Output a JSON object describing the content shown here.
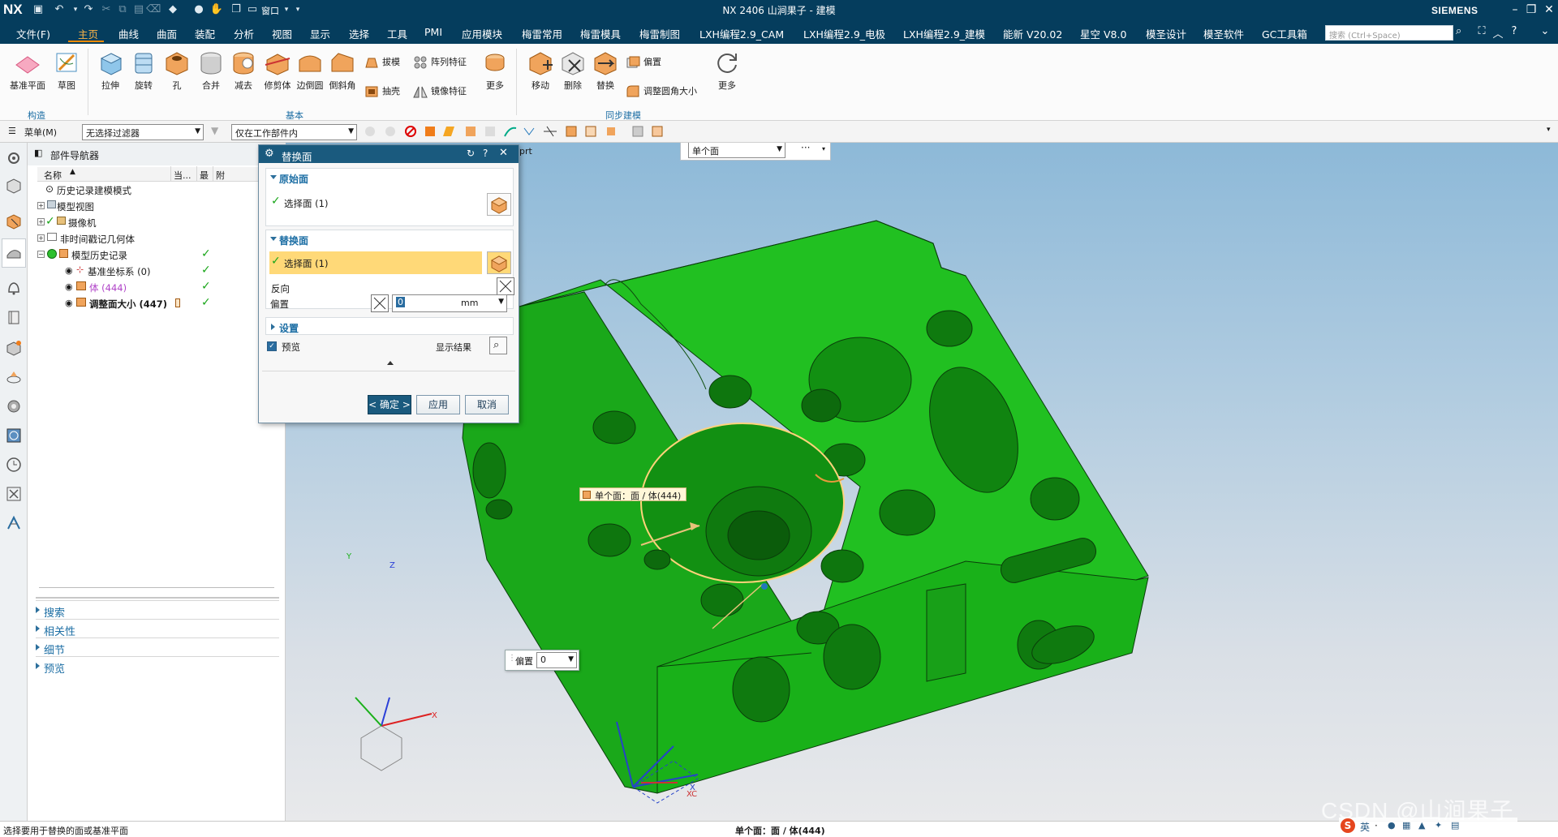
{
  "app": {
    "logo": "NX",
    "title": "NX 2406 山涧果子 - 建模",
    "brand": "SIEMENS",
    "window_menu": "窗口"
  },
  "menu": {
    "items": [
      "文件(F)",
      "主页",
      "曲线",
      "曲面",
      "装配",
      "分析",
      "视图",
      "显示",
      "选择",
      "工具",
      "PMI",
      "应用模块",
      "梅雷常用",
      "梅雷模具",
      "梅雷制图",
      "LXH编程2.9_CAM",
      "LXH编程2.9_电极",
      "LXH编程2.9_建模",
      "能新 V20.02",
      "星空 V8.0",
      "模圣设计",
      "模圣软件",
      "GC工具箱"
    ],
    "active": "主页",
    "search_placeholder": "搜索 (Ctrl+Space)"
  },
  "ribbon": {
    "construct": {
      "datum_plane": "基准平面",
      "sketch": "草图",
      "group": "构造"
    },
    "basic": {
      "extrude": "拉伸",
      "revolve": "旋转",
      "hole": "孔",
      "unite": "合并",
      "subtract": "减去",
      "trim_body": "修剪体",
      "edge_blend": "边倒圆",
      "chamfer": "倒斜角",
      "draft": "拔模",
      "shell": "抽壳",
      "pattern": "阵列特征",
      "mirror": "镜像特征",
      "more": "更多",
      "group": "基本"
    },
    "sync": {
      "move": "移动",
      "delete": "删除",
      "replace": "替换",
      "offset": "偏置",
      "resize_blend": "调整圆角大小",
      "more": "更多",
      "group": "同步建模"
    }
  },
  "selbar": {
    "menu": "菜单(M)",
    "filter": "无选择过滤器",
    "scope": "仅在工作部件内"
  },
  "navigator": {
    "title": "部件导航器",
    "columns": {
      "name": "名称",
      "current": "当...",
      "latest": "最",
      "attach": "附"
    },
    "rows": [
      {
        "label": "历史记录建模模式"
      },
      {
        "label": "模型视图"
      },
      {
        "label": "摄像机"
      },
      {
        "label": "非时间戳记几何体"
      },
      {
        "label": "模型历史记录"
      },
      {
        "label": "基准坐标系 (0)"
      },
      {
        "label": "体 (444)"
      },
      {
        "label": "调整面大小 (447)"
      }
    ],
    "sections": [
      "搜索",
      "相关性",
      "细节",
      "预览"
    ]
  },
  "viewport": {
    "tab_text": "prt",
    "filter_value": "单个面",
    "filter_more": "···",
    "tooltip": "单个面：面 / 体(444)",
    "offset_label": "偏置",
    "offset_value": "0"
  },
  "dialog": {
    "title": "替换面",
    "orig_section": "原始面",
    "orig_select": "选择面 (1)",
    "rep_section": "替换面",
    "rep_select": "选择面 (1)",
    "reverse": "反向",
    "offset": "偏置",
    "offset_value": "0",
    "offset_unit": "mm",
    "settings": "设置",
    "preview": "预览",
    "show_result": "显示结果",
    "ok": "< 确定 >",
    "apply": "应用",
    "cancel": "取消"
  },
  "status": {
    "left": "选择要用于替换的面或基准平面",
    "center": "单个面：面 / 体(444)",
    "watermark": "CSDN @山涧果子"
  },
  "colors": {
    "titlebar": "#053d5d",
    "part": "#1ec31e",
    "accent": "#ff8a00",
    "highlight": "#ffd978"
  }
}
